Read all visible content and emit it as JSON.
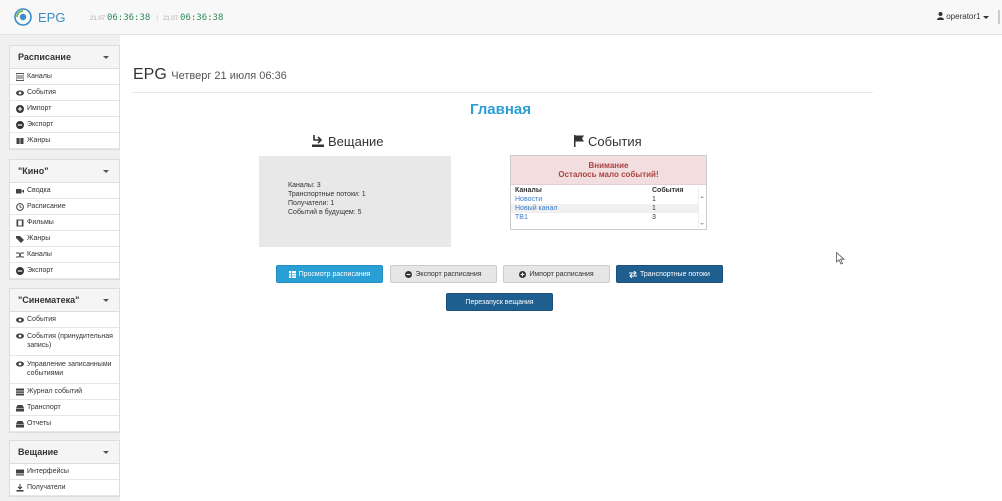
{
  "app": {
    "brand": "EPG"
  },
  "clocks": [
    {
      "date": "21.07",
      "time": "06:36:38"
    },
    {
      "date": "21.07",
      "time": "06:36:38"
    }
  ],
  "user": {
    "name": "operator1"
  },
  "sidebar": {
    "panels": [
      {
        "title": "Расписание",
        "items": [
          "Каналы",
          "События",
          "Импорт",
          "Экспорт",
          "Жанры"
        ]
      },
      {
        "title": "\"Кино\"",
        "items": [
          "Сводка",
          "Расписание",
          "Фильмы",
          "Жанры",
          "Каналы",
          "Экспорт"
        ]
      },
      {
        "title": "\"Синематека\"",
        "items": [
          "События",
          "События (принудительная запись)",
          "Управление записанными событиями",
          "Журнал событий",
          "Транспорт",
          "Отчеты"
        ]
      },
      {
        "title": "Вещание",
        "items": [
          "Интерфейсы",
          "Получатели"
        ]
      }
    ]
  },
  "page": {
    "title": "EPG",
    "subtitle": "Четверг 21 июля 06:36",
    "heading": "Главная"
  },
  "broadcast": {
    "header": "Вещание",
    "lines": [
      "Каналы: 3",
      "Транспортные потоки: 1",
      "Получатели: 1",
      "Событий в будущем: 5"
    ]
  },
  "events": {
    "header": "События",
    "warning_title": "Внимание",
    "warning_text": "Осталось мало событий!",
    "columns": [
      "Каналы",
      "События"
    ],
    "rows": [
      {
        "channel": "Новости",
        "count": "1"
      },
      {
        "channel": "Новый канал",
        "count": "1"
      },
      {
        "channel": "ТВ1",
        "count": "3"
      }
    ]
  },
  "buttons": {
    "view_schedule": "Просмотр расписания",
    "export_schedule": "Экспорт расписания",
    "import_schedule": "Импорт расписания",
    "transport_streams": "Транспортные потоки",
    "restart_broadcast": "Перезапуск вещания"
  },
  "colors": {
    "accent": "#2a9fd6",
    "primary": "#1f5f8f",
    "warning_bg": "#f2dede",
    "warning_text": "#a94442"
  }
}
